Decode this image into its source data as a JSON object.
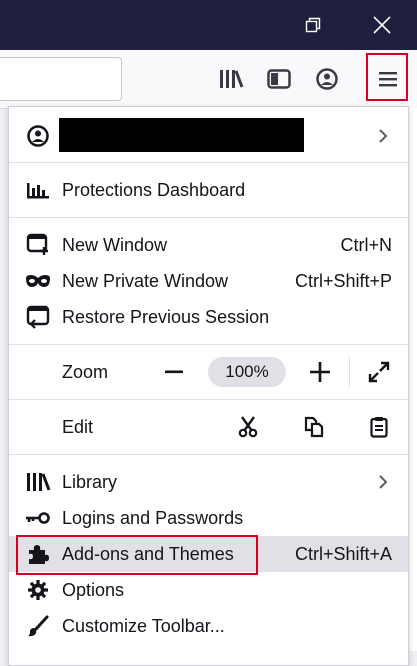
{
  "window": {
    "restore_icon": "restore-window-icon",
    "close_icon": "close-window-icon"
  },
  "toolbar": {
    "library_icon": "library-icon",
    "sidebar_icon": "sidebar-icon",
    "account_icon": "account-icon",
    "menu_icon": "hamburger-menu-icon"
  },
  "menu": {
    "account": {
      "icon": "account-icon"
    },
    "protections": {
      "label": "Protections Dashboard",
      "icon": "protections-dashboard-icon"
    },
    "new_window": {
      "label": "New Window",
      "shortcut": "Ctrl+N",
      "icon": "new-window-icon"
    },
    "new_private_window": {
      "label": "New Private Window",
      "shortcut": "Ctrl+Shift+P",
      "icon": "private-mask-icon"
    },
    "restore_session": {
      "label": "Restore Previous Session",
      "icon": "restore-session-icon"
    },
    "zoom": {
      "label": "Zoom",
      "value": "100%",
      "minus": "−",
      "plus": "+"
    },
    "edit": {
      "label": "Edit"
    },
    "library": {
      "label": "Library",
      "icon": "library-icon"
    },
    "logins": {
      "label": "Logins and Passwords",
      "icon": "key-icon"
    },
    "addons": {
      "label": "Add-ons and Themes",
      "shortcut": "Ctrl+Shift+A",
      "icon": "puzzle-piece-icon"
    },
    "options": {
      "label": "Options",
      "icon": "gear-icon"
    },
    "customize": {
      "label": "Customize Toolbar...",
      "icon": "paintbrush-icon"
    }
  },
  "colors": {
    "titlebar": "#1f1f3d",
    "highlight_box": "#d70022",
    "hover_row": "#e0e0e6"
  }
}
